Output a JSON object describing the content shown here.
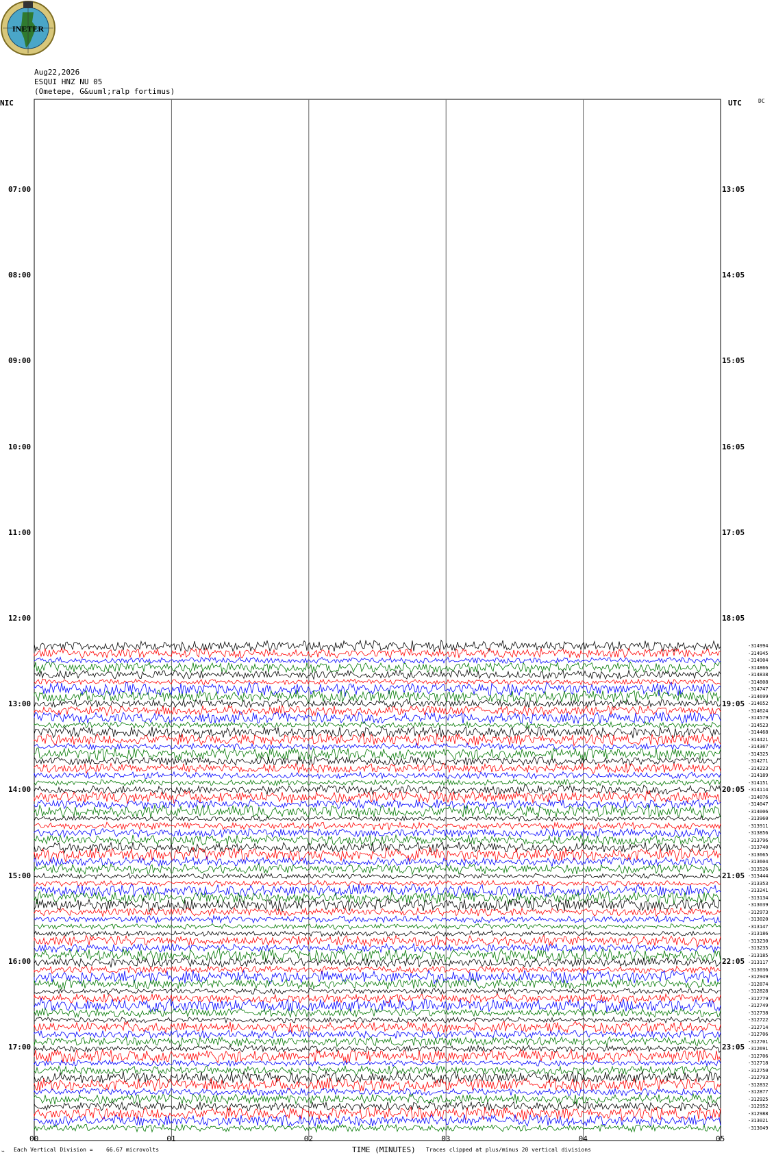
{
  "header": {
    "logo_text": "INETER",
    "date": "Aug22,2026",
    "station": "ESQUI HNZ NU 05",
    "location": "(Ometepe, G&uuml;ralp fortimus)"
  },
  "left_axis_label": "NIC",
  "right_axis_label": "UTC",
  "dc_label": "DC",
  "footer": {
    "scale_note": "Each Vertical Division =",
    "scale_value": "66.67 microvolts",
    "xlabel": "TIME (MINUTES)",
    "clip_note": "Traces clipped at plus/minus 20 vertical divisions"
  },
  "colors": {
    "black": "#000000",
    "red": "#ff0000",
    "blue": "#0000ff",
    "green": "#007700"
  },
  "chart_data": {
    "type": "line",
    "title": "ESQUI HNZ NU 05",
    "xlabel": "TIME (MINUTES)",
    "x_ticks": [
      "00",
      "01",
      "02",
      "03",
      "04",
      "05"
    ],
    "xlim": [
      0,
      5
    ],
    "left_hour_labels": [
      "07:00",
      "08:00",
      "09:00",
      "10:00",
      "11:00",
      "12:00",
      "13:00",
      "14:00",
      "15:00",
      "16:00",
      "17:00"
    ],
    "right_hour_labels": [
      "13:05",
      "14:05",
      "15:05",
      "16:05",
      "17:05",
      "18:05",
      "19:05",
      "20:05",
      "21:05",
      "22:05",
      "23:05"
    ],
    "trace_colors_cycle": [
      "black",
      "red",
      "blue",
      "green"
    ],
    "traces_start_row": 0,
    "trace_offsets": [
      -314994,
      -314945,
      -314904,
      -314866,
      -314838,
      -314808,
      -314747,
      -314699,
      -314652,
      -314624,
      -314579,
      -314523,
      -314468,
      -314421,
      -314367,
      -314325,
      -314271,
      -314223,
      -314189,
      -314151,
      -314114,
      -314076,
      -314047,
      -314006,
      -313960,
      -313911,
      -313856,
      -313796,
      -313740,
      -313665,
      -313604,
      -313526,
      -313444,
      -313353,
      -313241,
      -313134,
      -313039,
      -312973,
      -313020,
      -313147,
      -313186,
      -313230,
      -313235,
      -313185,
      -313117,
      -313036,
      -312949,
      -312874,
      -312828,
      -312779,
      -312749,
      -312738,
      -312722,
      -312714,
      -312706,
      -312701,
      -312691,
      -312706,
      -312718,
      -312750,
      -312793,
      -312832,
      -312877,
      -312925,
      -312952,
      -312988,
      -313021,
      -313049
    ]
  }
}
